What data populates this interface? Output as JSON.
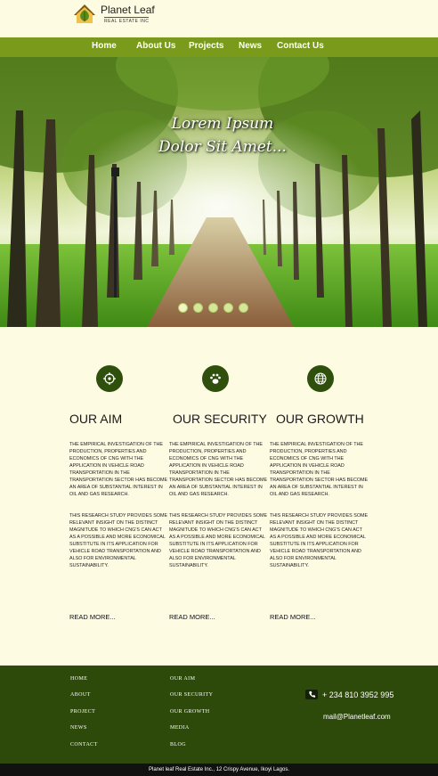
{
  "brand": {
    "name": "Planet Leaf",
    "tagline": "REAL ESTATE INC"
  },
  "nav": [
    "Home",
    "About Us",
    "Projects",
    "News",
    "Contact Us"
  ],
  "hero": {
    "line1": "Lorem Ipsum",
    "line2": "Dolor Sit Amet...",
    "slides": 5,
    "active_slide": 1
  },
  "features": [
    {
      "title": "OUR AIM",
      "icon": "target-icon",
      "p1": "THE EMPIRICAL INVESTIGATION OF THE PRODUCTION, PROPERTIES AND ECONOMICS OF CNG WITH THE APPLICATION IN VEHICLE ROAD TRANSPORTATION IN THE TRANSPORTATION SECTOR HAS BECOME AN AREA OF SUBSTANTIAL INTEREST IN OIL AND GAS RESEARCH.",
      "p2": "THIS RESEARCH STUDY PROVIDES SOME RELEVANT INSIGHT ON THE DISTINCT MAGNITUDE TO WHICH CNG'S CAN ACT AS A POSSIBLE AND MORE ECONOMICAL SUBSTITUTE IN ITS APPLICATION FOR VEHICLE ROAD TRANSPORTATION AND ALSO FOR ENVIRONMENTAL SUSTAINABILITY.",
      "more": "READ MORE..."
    },
    {
      "title": "OUR SECURITY",
      "icon": "paw-icon",
      "p1": "THE EMPIRICAL INVESTIGATION OF THE PRODUCTION, PROPERTIES AND ECONOMICS OF CNG WITH THE APPLICATION IN VEHICLE ROAD TRANSPORTATION IN THE TRANSPORTATION SECTOR HAS BECOME AN AREA OF SUBSTANTIAL INTEREST IN OIL AND GAS RESEARCH.",
      "p2": "THIS RESEARCH STUDY PROVIDES SOME RELEVANT INSIGHT ON THE DISTINCT MAGNITUDE TO WHICH CNG'S CAN ACT AS A POSSIBLE AND MORE ECONOMICAL SUBSTITUTE IN ITS APPLICATION FOR VEHICLE ROAD TRANSPORTATION AND ALSO FOR ENVIRONMENTAL SUSTAINABILITY.",
      "more": "READ MORE..."
    },
    {
      "title": "OUR GROWTH",
      "icon": "globe-icon",
      "p1": "THE EMPIRICAL INVESTIGATION OF THE PRODUCTION, PROPERTIES AND ECONOMICS OF CNG WITH THE APPLICATION IN VEHICLE ROAD TRANSPORTATION IN THE TRANSPORTATION SECTOR HAS BECOME AN AREA OF SUBSTANTIAL INTEREST IN OIL AND GAS RESEARCH.",
      "p2": "THIS RESEARCH STUDY PROVIDES SOME RELEVANT INSIGHT ON THE DISTINCT MAGNITUDE TO WHICH CNG'S CAN ACT AS A POSSIBLE AND MORE ECONOMICAL SUBSTITUTE IN ITS APPLICATION FOR VEHICLE ROAD TRANSPORTATION AND ALSO FOR ENVIRONMENTAL SUSTAINABILITY.",
      "more": "READ MORE..."
    }
  ],
  "footer": {
    "col1": [
      "HOME",
      "ABOUT",
      "PROJECT",
      "NEWS",
      "CONTACT"
    ],
    "col2": [
      "OUR AIM",
      "OUR SECURITY",
      "OUR GROWTH",
      "MEDIA",
      "BLOG"
    ],
    "phone": "+ 234 810 3952 995",
    "email": "mail@Planetleaf.com",
    "copyright": "Planet leaf Real Estate Inc., 12 Crispy Avenue, Ikoyi Lagos."
  },
  "colors": {
    "nav": "#7a9a1b",
    "footer": "#2e4a0b",
    "background": "#fdfbe2",
    "icon_bg": "#2f4f0d"
  }
}
